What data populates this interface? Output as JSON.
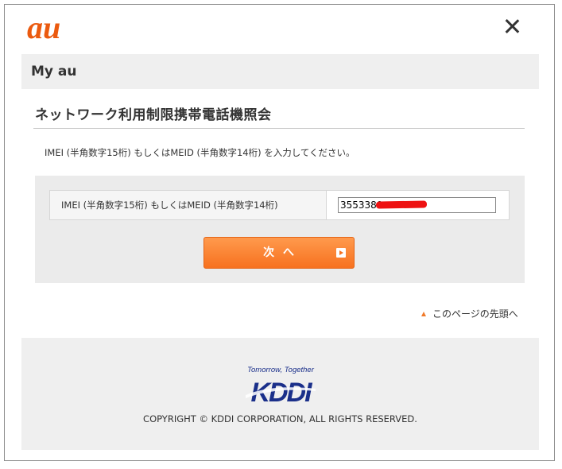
{
  "header": {
    "logo_text": "au",
    "close_icon": "close-icon"
  },
  "band": {
    "title": "My au"
  },
  "page": {
    "heading": "ネットワーク利用制限携帯電話機照会",
    "instruction": "IMEI (半角数字15桁) もしくはMEID (半角数字14桁) を入力してください。"
  },
  "form": {
    "field_label": "IMEI (半角数字15桁) もしくはMEID (半角数字14桁)",
    "field_value": "3553380",
    "next_label": "次 へ",
    "next_icon": "arrow-right-icon"
  },
  "pagetop": {
    "label": "このページの先頭へ",
    "icon": "triangle-up-icon"
  },
  "footer": {
    "tagline": "Tomorrow, Together",
    "brand": "KDDI",
    "copyright": "COPYRIGHT © KDDI CORPORATION, ALL RIGHTS RESERVED."
  },
  "colors": {
    "accent": "#f7711f",
    "logo": "#eb5a0f",
    "kddi_blue": "#1a2f8a"
  }
}
